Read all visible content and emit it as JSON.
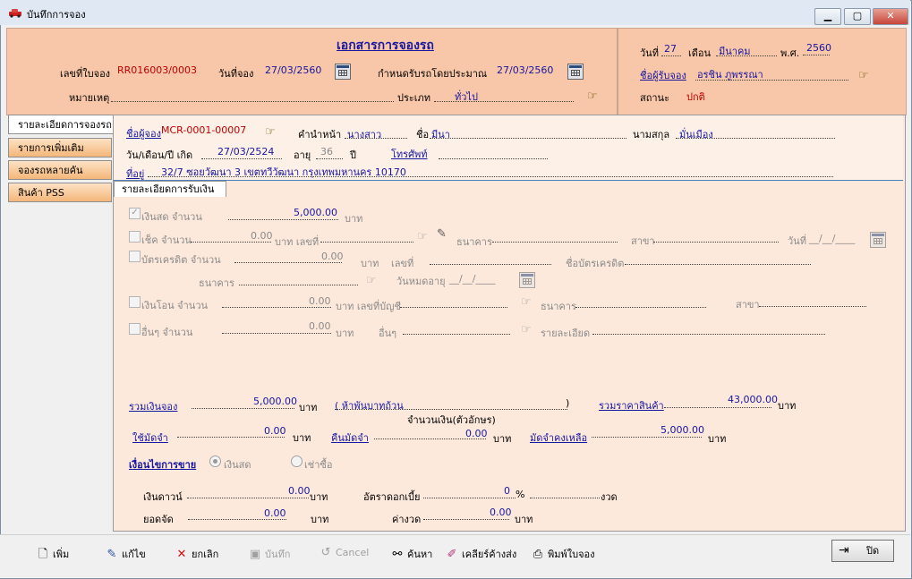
{
  "window": {
    "title": "บันทึกการจอง",
    "minimize": "▁",
    "maximize": "▢",
    "close": "✕"
  },
  "header": {
    "doc_title": "เอกสารการจองรถ",
    "booking_no_label": "เลขที่ใบจอง",
    "booking_no_value": "RR016003/0003",
    "booking_date_label": "วันที่จอง",
    "booking_date_value": "27/03/2560",
    "delivery_label": "กำหนดรับรถโดยประมาณ",
    "delivery_value": "27/03/2560",
    "remark_label": "หมายเหตุ",
    "type_label": "ประเภท",
    "type_value": "ทั่วไป",
    "day_label": "วันที่",
    "day_value": "27",
    "month_label": "เดือน",
    "month_value": "มีนาคม",
    "year_label": "พ.ศ.",
    "year_value": "2560",
    "receiver_label": "ชื่อผู้รับจอง",
    "receiver_value": "อรชิน ภูพรรณา",
    "status_label": "สถานะ",
    "status_value": "ปกติ"
  },
  "tabs": [
    {
      "label": "รายละเอียดการจองรถ"
    },
    {
      "label": "รายการเพิ่มเติม"
    },
    {
      "label": "จองรถหลายคัน"
    },
    {
      "label": "สินค้า PSS"
    }
  ],
  "customer": {
    "booker_label": "ชื่อผู้จอง",
    "booker_value": "MCR-0001-00007",
    "prefix_label": "คำนำหน้า",
    "prefix_value": "นางสาว",
    "name_label": "ชื่อ",
    "name_value": "มีนา",
    "surname_label": "นามสกุล",
    "surname_value": "มั่นเมือง",
    "birth_label": "วัน/เดือน/ปี เกิด",
    "birth_value": "27/03/2524",
    "age_label": "อายุ",
    "age_value": "36",
    "age_unit": "ปี",
    "phone_label": "โทรศัพท์",
    "address_label": "ที่อยู่",
    "address_value": "32/7 ซอยวัฒนา 3 เขตทวีวัฒนา กรุงเทพมหานคร 10170"
  },
  "payment": {
    "subtab": "รายละเอียดการรับเงิน",
    "cash_label": "เงินสด จำนวน",
    "cash_value": "5,000.00",
    "baht": "บาท",
    "cheque_label": "เช็ค จำนวน",
    "cheque_value": "0.00",
    "baht_no": "บาท เลขที่",
    "bank_label": "ธนาคาร",
    "branch_label": "สาขา",
    "date_label": "วันที่",
    "date_blank": "__/__/____",
    "card_label": "บัตรเครดิต จำนวน",
    "card_value": "0.00",
    "no_label": "เลขที่",
    "card_name_label": "ชื่อบัตรเครดิต",
    "bank2_label": "ธนาคาร",
    "expire_label": "วันหมดอายุ",
    "expire_blank": "__/__/____",
    "transfer_label": "เงินโอน จำนวน",
    "transfer_value": "0.00",
    "account_label": "บาท เลขที่บัญชี",
    "bank3_label": "ธนาคาร",
    "branch3_label": "สาขา",
    "other_label": "อื่นๆ จำนวน",
    "other_value": "0.00",
    "other_field_label": "อื่นๆ",
    "detail_label": "รายละเอียด"
  },
  "summary": {
    "total_label": "รวมเงินจอง",
    "total_value": "5,000.00",
    "baht": "บาท",
    "total_text": "( ห้าพันบาทถ้วน",
    "paren_close": ")",
    "text_caption": "จำนวนเงิน(ตัวอักษร)",
    "price_label": "รวมราคาสินค้า",
    "price_value": "43,000.00",
    "deposit_used_label": "ใช้มัดจำ",
    "deposit_used_value": "0.00",
    "deposit_return_label": "คืนมัดจำ",
    "deposit_return_value": "0.00",
    "deposit_left_label": "มัดจำคงเหลือ",
    "deposit_left_value": "5,000.00",
    "sale_cond_label": "เงื่อนไขการขาย",
    "opt_cash": "เงินสด",
    "opt_hire": "เช่าซื้อ",
    "down_label": "เงินดาวน์",
    "down_value": "0.00",
    "interest_label": "อัตราดอกเบี้ย",
    "interest_value": "0",
    "percent": "%",
    "installments": "งวด",
    "finance_label": "ยอดจัด",
    "finance_value": "0.00",
    "per_label": "ค่างวด",
    "per_value": "0.00"
  },
  "toolbar": {
    "add": "เพิ่ม",
    "edit": "แก้ไข",
    "cancel_doc": "ยกเลิก",
    "save": "บันทึก",
    "cancel": "Cancel",
    "search": "ค้นหา",
    "clear": "เคลียร์ค้างส่ง",
    "print": "พิมพ์ใบจอง",
    "close": "ปิด"
  }
}
